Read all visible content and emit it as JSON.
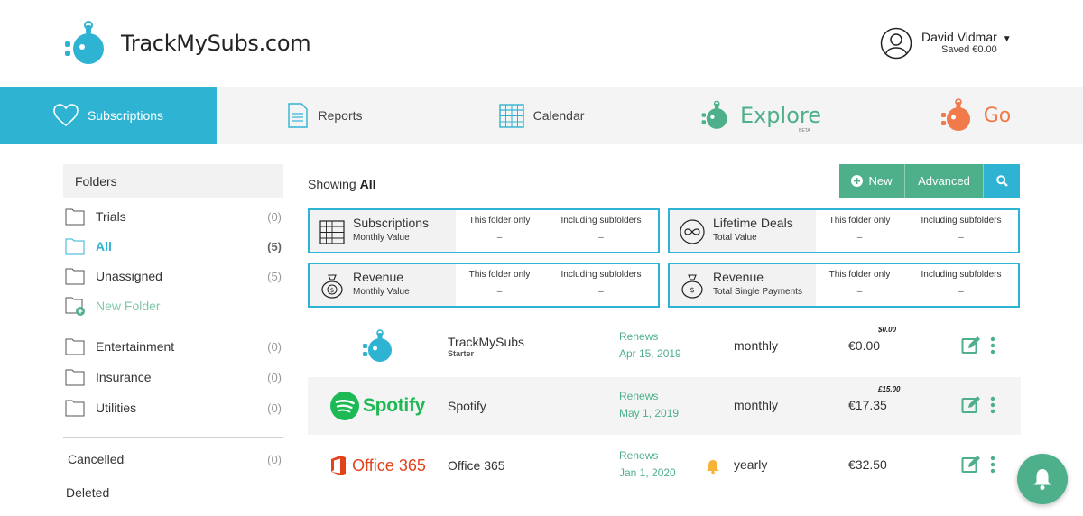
{
  "brand": {
    "name": "TrackMySubs.com"
  },
  "user": {
    "name": "David Vidmar",
    "saved": "Saved €0.00"
  },
  "nav": {
    "subscriptions": "Subscriptions",
    "reports": "Reports",
    "calendar": "Calendar",
    "explore": "Explore",
    "explore_badge": "BETA",
    "go": "Go"
  },
  "sidebar": {
    "heading": "Folders",
    "folders": [
      {
        "name": "Trials",
        "count": "(0)"
      },
      {
        "name": "All",
        "count": "(5)"
      },
      {
        "name": "Unassigned",
        "count": "(5)"
      },
      {
        "name": "New Folder",
        "count": ""
      },
      {
        "name": "Entertainment",
        "count": "(0)"
      },
      {
        "name": "Insurance",
        "count": "(0)"
      },
      {
        "name": "Utilities",
        "count": "(0)"
      }
    ],
    "cancelled": {
      "name": "Cancelled",
      "count": "(0)"
    },
    "deleted": "Deleted"
  },
  "main": {
    "showing_prefix": "Showing ",
    "showing_value": "All",
    "toolbar": {
      "new": "New",
      "advanced": "Advanced"
    },
    "stats": [
      {
        "title": "Subscriptions",
        "sub": "Monthly Value",
        "col1": "This folder only",
        "col2": "Including subfolders",
        "val1": "–",
        "val2": "–",
        "icon": "calendar-grid-icon"
      },
      {
        "title": "Lifetime Deals",
        "sub": "Total Value",
        "col1": "This folder only",
        "col2": "Including subfolders",
        "val1": "–",
        "val2": "–",
        "icon": "infinity-icon"
      },
      {
        "title": "Revenue",
        "sub": "Monthly Value",
        "col1": "This folder only",
        "col2": "Including subfolders",
        "val1": "–",
        "val2": "–",
        "icon": "money-bag-icon"
      },
      {
        "title": "Revenue",
        "sub": "Total Single Payments",
        "col1": "This folder only",
        "col2": "Including subfolders",
        "val1": "–",
        "val2": "–",
        "icon": "money-bag-icon"
      }
    ],
    "subscriptions": [
      {
        "logo_text": "",
        "name": "TrackMySubs",
        "plan": "Starter",
        "renew_label": "Renews",
        "renew_date": "Apr 15, 2019",
        "cycle": "monthly",
        "price": "€0.00",
        "original": "$0.00"
      },
      {
        "logo_text": "Spotify",
        "name": "Spotify",
        "plan": "",
        "renew_label": "Renews",
        "renew_date": "May 1, 2019",
        "cycle": "monthly",
        "price": "€17.35",
        "original": "£15.00"
      },
      {
        "logo_text": "Office 365",
        "name": "Office 365",
        "plan": "",
        "renew_label": "Renews",
        "renew_date": "Jan 1, 2020",
        "cycle": "yearly",
        "price": "€32.50",
        "original": ""
      }
    ]
  },
  "colors": {
    "primary": "#2fb3d3",
    "green": "#4db08a",
    "orange": "#f07a4a",
    "office": "#e3421b",
    "spotify": "#1db954"
  }
}
